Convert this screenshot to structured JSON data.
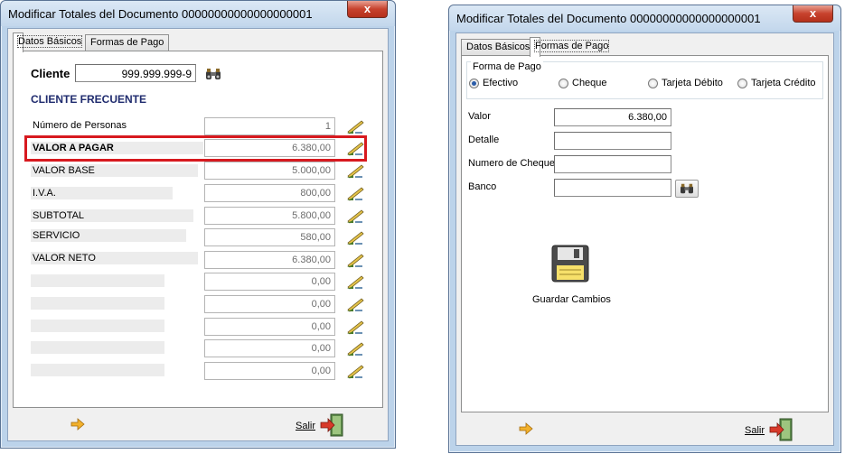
{
  "colors": {
    "highlight_box": "#d7191f",
    "client_frecuente": "#1f2b6e"
  },
  "left": {
    "title": "Modificar Totales del Documento 00000000000000000001",
    "close_label": "x",
    "tabs": [
      "Datos Básicos",
      "Formas de Pago"
    ],
    "active_tab": 0,
    "cliente_label": "Cliente",
    "cliente_value": "999.999.999-9",
    "frecuente_label": "CLIENTE FRECUENTE",
    "rows": [
      {
        "label": "Número de Personas",
        "value": "1",
        "bold": false
      },
      {
        "label": "VALOR A PAGAR",
        "value": "6.380,00",
        "bold": true
      },
      {
        "label": "VALOR BASE",
        "value": "5.000,00",
        "bold": false
      },
      {
        "label": "I.V.A.",
        "value": "800,00",
        "bold": false
      },
      {
        "label": "SUBTOTAL",
        "value": "5.800,00",
        "bold": false
      },
      {
        "label": "SERVICIO",
        "value": "580,00",
        "bold": false
      },
      {
        "label": "VALOR NETO",
        "value": "6.380,00",
        "bold": false
      },
      {
        "label": "",
        "value": "0,00",
        "bold": false
      },
      {
        "label": "",
        "value": "0,00",
        "bold": false
      },
      {
        "label": "",
        "value": "0,00",
        "bold": false
      },
      {
        "label": "",
        "value": "0,00",
        "bold": false
      },
      {
        "label": "",
        "value": "0,00",
        "bold": false
      }
    ],
    "salir_label": "Salir"
  },
  "right": {
    "title": "Modificar Totales del Documento 00000000000000000001",
    "close_label": "x",
    "tabs": [
      "Datos Básicos",
      "Formas de Pago"
    ],
    "active_tab": 1,
    "forma_pago_label": "Forma de Pago",
    "radios": [
      {
        "label": "Efectivo",
        "checked": true
      },
      {
        "label": "Cheque",
        "checked": false
      },
      {
        "label": "Tarjeta Débito",
        "checked": false
      },
      {
        "label": "Tarjeta Crédito",
        "checked": false
      }
    ],
    "valor_label": "Valor",
    "valor_value": "6.380,00",
    "detalle_label": "Detalle",
    "detalle_value": "",
    "cheque_label": "Numero de Cheque",
    "cheque_value": "",
    "banco_label": "Banco",
    "banco_value": "",
    "guardar_label": "Guardar Cambios",
    "salir_label": "Salir"
  }
}
